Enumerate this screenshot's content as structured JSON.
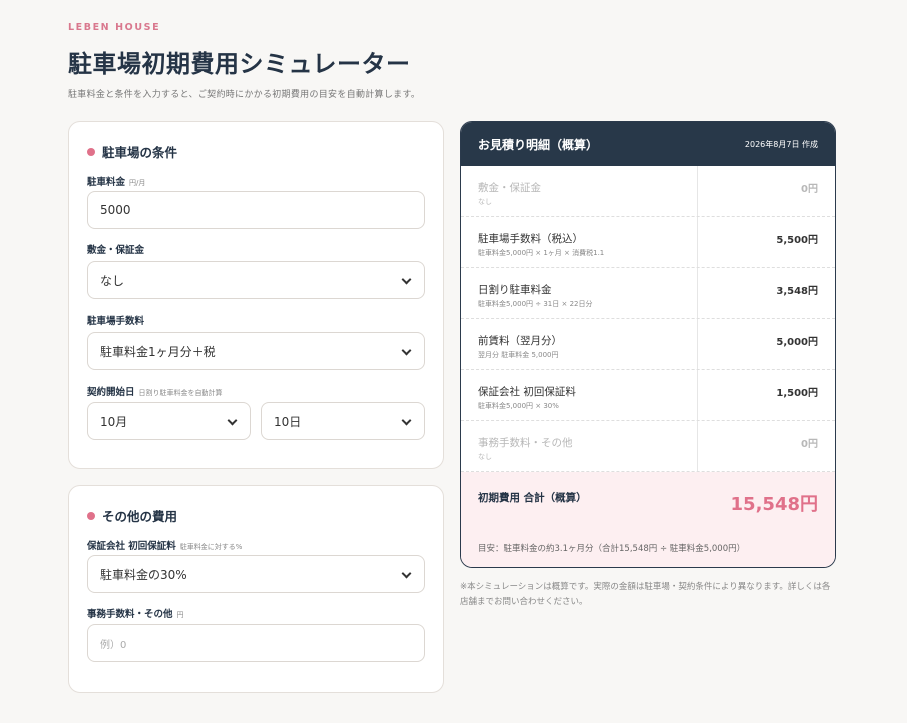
{
  "brand": "LEBEN HOUSE",
  "title": "駐車場初期費用シミュレーター",
  "subtitle": "駐車料金と条件を入力すると、ご契約時にかかる初期費用の目安を自動計算します。",
  "conditions": {
    "title": "駐車場の条件",
    "fee": {
      "label": "駐車料金",
      "hint": "円/月",
      "value": "5000"
    },
    "deposit": {
      "label": "敷金・保証金",
      "value": "なし"
    },
    "commission": {
      "label": "駐車場手数料",
      "value": "駐車料金1ヶ月分＋税"
    },
    "start": {
      "label": "契約開始日",
      "hint": "日割り駐車料金を自動計算",
      "month": "10月",
      "day": "10日"
    }
  },
  "other": {
    "title": "その他の費用",
    "guarantee": {
      "label": "保証会社 初回保証料",
      "hint": "駐車料金に対する%",
      "value": "駐車料金の30%"
    },
    "admin": {
      "label": "事務手数料・その他",
      "hint": "円",
      "placeholder": "例）0"
    }
  },
  "estimate": {
    "header": "お見積り明細（概算）",
    "date": "2026年8月7日 作成",
    "rows": [
      {
        "label": "敷金・保証金",
        "sub": "なし",
        "value": "0円"
      },
      {
        "label": "駐車場手数料（税込）",
        "sub": "駐車料金5,000円 × 1ヶ月 × 消費税1.1",
        "value": "5,500円"
      },
      {
        "label": "日割り駐車料金",
        "sub": "駐車料金5,000円 ÷ 31日 × 22日分",
        "value": "3,548円"
      },
      {
        "label": "前賃料（翌月分）",
        "sub": "翌月分 駐車料金 5,000円",
        "value": "5,000円"
      },
      {
        "label": "保証会社 初回保証料",
        "sub": "駐車料金5,000円 × 30%",
        "value": "1,500円"
      },
      {
        "label": "事務手数料・その他",
        "sub": "なし",
        "value": "0円"
      }
    ],
    "total": {
      "label": "初期費用 合計（概算）",
      "value": "15,548円",
      "note": "目安：駐車料金の約3.1ヶ月分（合計15,548円 ÷ 駐車料金5,000円）"
    }
  },
  "disclaimer": "※本シミュレーションは概算です。実際の金額は駐車場・契約条件により異なります。詳しくは各店舗までお問い合わせください。"
}
